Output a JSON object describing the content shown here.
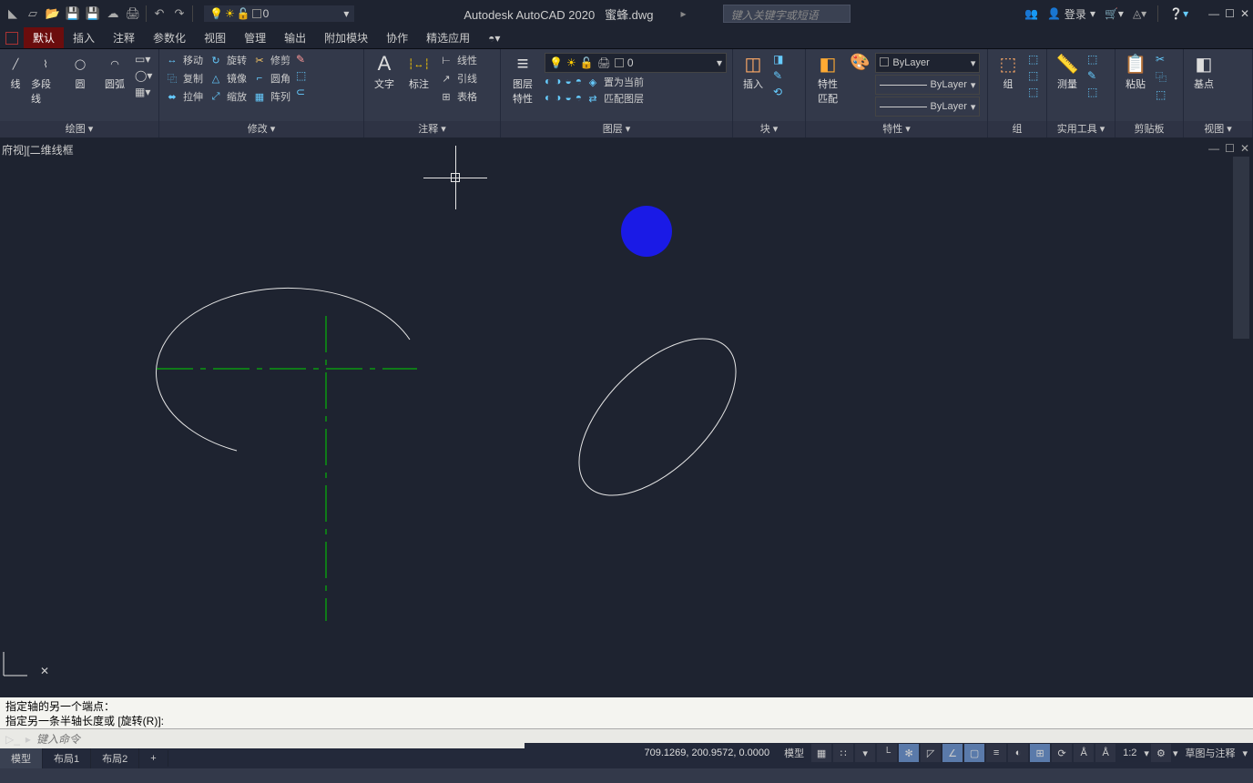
{
  "title": {
    "app": "Autodesk AutoCAD 2020",
    "file": "蜜蜂.dwg"
  },
  "search_placeholder": "键入关键字或短语",
  "login": "登录",
  "layer_quick_value": "0",
  "menu": {
    "tabs": [
      "默认",
      "插入",
      "注释",
      "参数化",
      "视图",
      "管理",
      "输出",
      "附加模块",
      "协作",
      "精选应用"
    ]
  },
  "ribbon": {
    "draw": {
      "title": "绘图 ▾",
      "polyline": "多段线",
      "circle": "圆",
      "arc": "圆弧",
      "line_partial": "线"
    },
    "modify": {
      "title": "修改 ▾",
      "move": "移动",
      "rotate": "旋转",
      "trim": "修剪",
      "copy": "复制",
      "mirror": "镜像",
      "fillet": "圆角",
      "stretch": "拉伸",
      "scale": "缩放",
      "array": "阵列"
    },
    "annotate": {
      "title": "注释 ▾",
      "text": "文字",
      "dim": "标注",
      "line_style": "线性",
      "leader": "引线",
      "table": "表格"
    },
    "layers": {
      "title": "图层 ▾",
      "props": "图层\n特性",
      "set_current": "置为当前",
      "match": "匹配图层",
      "value": "0"
    },
    "block": {
      "title": "块 ▾",
      "insert": "插入"
    },
    "props": {
      "title": "特性 ▾",
      "match": "特性\n匹配",
      "bylayer": "ByLayer"
    },
    "group": {
      "title": "组",
      "label": "组"
    },
    "util": {
      "title": "实用工具 ▾",
      "measure": "测量"
    },
    "clipboard": {
      "title": "剪贴板",
      "paste": "粘贴"
    },
    "viewpanel": {
      "title": "视图 ▾",
      "base": "基点"
    }
  },
  "viewport_label": "府视][二维线框",
  "cmd_log": {
    "line1": "指定轴的另一个端点：",
    "line2": "指定另一条半轴长度或 [旋转(R)]:"
  },
  "cmd_placeholder": "键入命令",
  "tabs": {
    "model": "模型",
    "layout1": "布局1",
    "layout2": "布局2"
  },
  "status": {
    "coords": "709.1269, 200.9572, 0.0000",
    "model": "模型",
    "scale": "1:2",
    "anno": "草图与注释"
  }
}
